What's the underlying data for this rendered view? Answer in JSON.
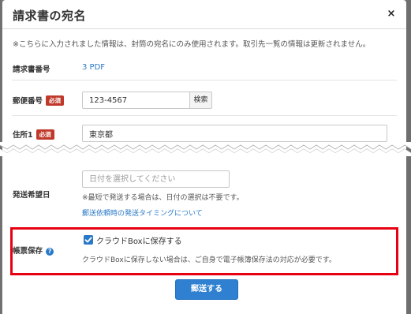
{
  "dialog": {
    "title": "請求書の宛名",
    "close_glyph": "×",
    "notice": "※こちらに入力されました情報は、封筒の宛名にのみ使用されます。取引先一覧の情報は更新されません。"
  },
  "invoice_number": {
    "label": "請求書番号",
    "value": "3 PDF"
  },
  "postal_code": {
    "label": "郵便番号",
    "required_badge": "必須",
    "value": "123-4567",
    "search_button": "検索"
  },
  "address1": {
    "label": "住所1",
    "required_badge": "必須",
    "value": "東京都"
  },
  "delivery_date": {
    "label": "発送希望日",
    "placeholder": "日付を選択してください",
    "hint": "※最短で発送する場合は、日付の選択は不要です。",
    "link": "郵送依頼時の発送タイミングについて"
  },
  "document_storage": {
    "label": "帳票保存",
    "help_glyph": "?",
    "checkbox_label": "クラウドBoxに保存する",
    "checked": true,
    "hint": "クラウドBoxに保存しない場合は、ご自身で電子帳簿保存法の対応が必要です。"
  },
  "submit_button": "郵送する",
  "colors": {
    "accent": "#2f80d0",
    "required": "#c0392b",
    "highlight": "#e60012",
    "link": "#2a79c8"
  }
}
